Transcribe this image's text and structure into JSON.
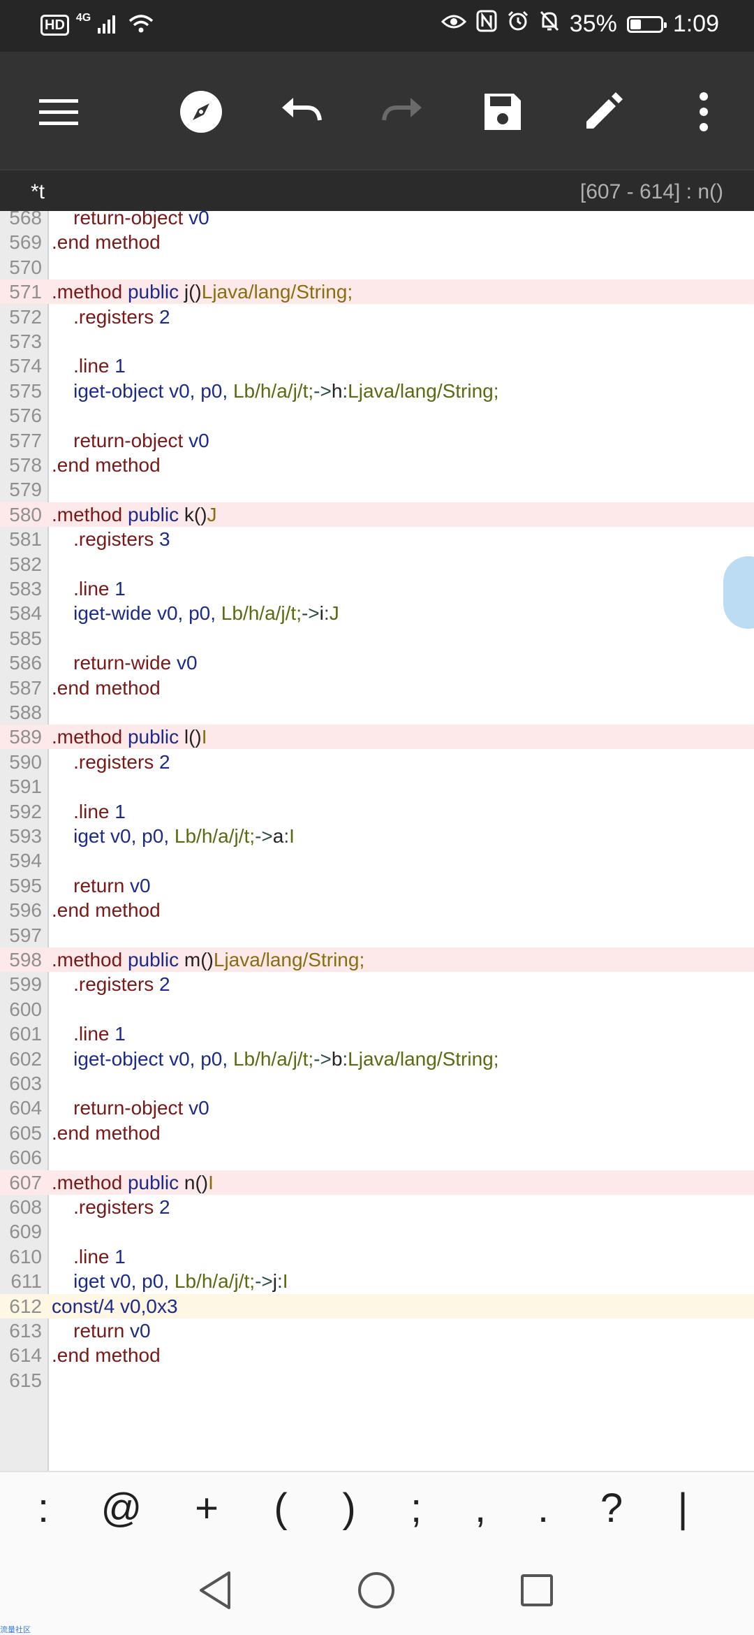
{
  "status_bar": {
    "hd_badge": "HD",
    "network": "4G",
    "battery_percent": "35%",
    "battery_level": 0.35,
    "time": "1:09"
  },
  "toolbar": {
    "icons": [
      "menu-icon",
      "compass-icon",
      "undo-icon",
      "redo-icon",
      "save-icon",
      "edit-icon",
      "more-vert-icon"
    ],
    "redo_enabled": false
  },
  "info_bar": {
    "file_name": "*t",
    "position": "[607 - 614] : n()"
  },
  "editor": {
    "lines": [
      {
        "num": "568",
        "tokens": [
          {
            "t": "    return-object ",
            "c": "kw"
          },
          {
            "t": "v0",
            "c": "reg"
          }
        ]
      },
      {
        "num": "569",
        "tokens": [
          {
            "t": ".end method",
            "c": "kw"
          }
        ]
      },
      {
        "num": "570",
        "tokens": []
      },
      {
        "num": "571",
        "hl": "method",
        "tokens": [
          {
            "t": ".method ",
            "c": "kw"
          },
          {
            "t": "public ",
            "c": "reg"
          },
          {
            "t": "j()",
            "c": "nm"
          },
          {
            "t": "Ljava/lang/String;",
            "c": "typ"
          }
        ]
      },
      {
        "num": "572",
        "tokens": [
          {
            "t": "    .registers ",
            "c": "kw"
          },
          {
            "t": "2",
            "c": "reg"
          }
        ]
      },
      {
        "num": "573",
        "tokens": []
      },
      {
        "num": "574",
        "tokens": [
          {
            "t": "    .line ",
            "c": "kw"
          },
          {
            "t": "1",
            "c": "reg"
          }
        ]
      },
      {
        "num": "575",
        "tokens": [
          {
            "t": "    iget-object ",
            "c": "reg"
          },
          {
            "t": "v0, p0, ",
            "c": "reg"
          },
          {
            "t": "Lb/h/a/j/t;",
            "c": "cls"
          },
          {
            "t": "->",
            "c": "op"
          },
          {
            "t": "h",
            "c": "nm"
          },
          {
            "t": ":",
            "c": "op"
          },
          {
            "t": "Ljava/lang/String;",
            "c": "cls"
          }
        ]
      },
      {
        "num": "576",
        "tokens": []
      },
      {
        "num": "577",
        "tokens": [
          {
            "t": "    return-object ",
            "c": "kw"
          },
          {
            "t": "v0",
            "c": "reg"
          }
        ]
      },
      {
        "num": "578",
        "tokens": [
          {
            "t": ".end method",
            "c": "kw"
          }
        ]
      },
      {
        "num": "579",
        "tokens": []
      },
      {
        "num": "580",
        "hl": "method",
        "tokens": [
          {
            "t": ".method ",
            "c": "kw"
          },
          {
            "t": "public ",
            "c": "reg"
          },
          {
            "t": "k()",
            "c": "nm"
          },
          {
            "t": "J",
            "c": "typ"
          }
        ]
      },
      {
        "num": "581",
        "tokens": [
          {
            "t": "    .registers ",
            "c": "kw"
          },
          {
            "t": "3",
            "c": "reg"
          }
        ]
      },
      {
        "num": "582",
        "tokens": []
      },
      {
        "num": "583",
        "tokens": [
          {
            "t": "    .line ",
            "c": "kw"
          },
          {
            "t": "1",
            "c": "reg"
          }
        ]
      },
      {
        "num": "584",
        "tokens": [
          {
            "t": "    iget-wide ",
            "c": "reg"
          },
          {
            "t": "v0, p0, ",
            "c": "reg"
          },
          {
            "t": "Lb/h/a/j/t;",
            "c": "cls"
          },
          {
            "t": "->",
            "c": "op"
          },
          {
            "t": "i",
            "c": "nm"
          },
          {
            "t": ":",
            "c": "op"
          },
          {
            "t": "J",
            "c": "cls"
          }
        ]
      },
      {
        "num": "585",
        "tokens": []
      },
      {
        "num": "586",
        "tokens": [
          {
            "t": "    return-wide ",
            "c": "kw"
          },
          {
            "t": "v0",
            "c": "reg"
          }
        ]
      },
      {
        "num": "587",
        "tokens": [
          {
            "t": ".end method",
            "c": "kw"
          }
        ]
      },
      {
        "num": "588",
        "tokens": []
      },
      {
        "num": "589",
        "hl": "method",
        "tokens": [
          {
            "t": ".method ",
            "c": "kw"
          },
          {
            "t": "public ",
            "c": "reg"
          },
          {
            "t": "l()",
            "c": "nm"
          },
          {
            "t": "I",
            "c": "typ"
          }
        ]
      },
      {
        "num": "590",
        "tokens": [
          {
            "t": "    .registers ",
            "c": "kw"
          },
          {
            "t": "2",
            "c": "reg"
          }
        ]
      },
      {
        "num": "591",
        "tokens": []
      },
      {
        "num": "592",
        "tokens": [
          {
            "t": "    .line ",
            "c": "kw"
          },
          {
            "t": "1",
            "c": "reg"
          }
        ]
      },
      {
        "num": "593",
        "tokens": [
          {
            "t": "    iget ",
            "c": "reg"
          },
          {
            "t": "v0, p0, ",
            "c": "reg"
          },
          {
            "t": "Lb/h/a/j/t;",
            "c": "cls"
          },
          {
            "t": "->",
            "c": "op"
          },
          {
            "t": "a",
            "c": "nm"
          },
          {
            "t": ":",
            "c": "op"
          },
          {
            "t": "I",
            "c": "cls"
          }
        ]
      },
      {
        "num": "594",
        "tokens": []
      },
      {
        "num": "595",
        "tokens": [
          {
            "t": "    return ",
            "c": "kw"
          },
          {
            "t": "v0",
            "c": "reg"
          }
        ]
      },
      {
        "num": "596",
        "tokens": [
          {
            "t": ".end method",
            "c": "kw"
          }
        ]
      },
      {
        "num": "597",
        "tokens": []
      },
      {
        "num": "598",
        "hl": "method",
        "tokens": [
          {
            "t": ".method ",
            "c": "kw"
          },
          {
            "t": "public ",
            "c": "reg"
          },
          {
            "t": "m()",
            "c": "nm"
          },
          {
            "t": "Ljava/lang/String;",
            "c": "typ"
          }
        ]
      },
      {
        "num": "599",
        "tokens": [
          {
            "t": "    .registers ",
            "c": "kw"
          },
          {
            "t": "2",
            "c": "reg"
          }
        ]
      },
      {
        "num": "600",
        "tokens": []
      },
      {
        "num": "601",
        "tokens": [
          {
            "t": "    .line ",
            "c": "kw"
          },
          {
            "t": "1",
            "c": "reg"
          }
        ]
      },
      {
        "num": "602",
        "tokens": [
          {
            "t": "    iget-object ",
            "c": "reg"
          },
          {
            "t": "v0, p0, ",
            "c": "reg"
          },
          {
            "t": "Lb/h/a/j/t;",
            "c": "cls"
          },
          {
            "t": "->",
            "c": "op"
          },
          {
            "t": "b",
            "c": "nm"
          },
          {
            "t": ":",
            "c": "op"
          },
          {
            "t": "Ljava/lang/String;",
            "c": "cls"
          }
        ]
      },
      {
        "num": "603",
        "tokens": []
      },
      {
        "num": "604",
        "tokens": [
          {
            "t": "    return-object ",
            "c": "kw"
          },
          {
            "t": "v0",
            "c": "reg"
          }
        ]
      },
      {
        "num": "605",
        "tokens": [
          {
            "t": ".end method",
            "c": "kw"
          }
        ]
      },
      {
        "num": "606",
        "tokens": []
      },
      {
        "num": "607",
        "hl": "method",
        "tokens": [
          {
            "t": ".method ",
            "c": "kw"
          },
          {
            "t": "public ",
            "c": "reg"
          },
          {
            "t": "n()",
            "c": "nm"
          },
          {
            "t": "I",
            "c": "typ"
          }
        ]
      },
      {
        "num": "608",
        "tokens": [
          {
            "t": "    .registers ",
            "c": "kw"
          },
          {
            "t": "2",
            "c": "reg"
          }
        ]
      },
      {
        "num": "609",
        "tokens": []
      },
      {
        "num": "610",
        "tokens": [
          {
            "t": "    .line ",
            "c": "kw"
          },
          {
            "t": "1",
            "c": "reg"
          }
        ]
      },
      {
        "num": "611",
        "tokens": [
          {
            "t": "    iget ",
            "c": "reg"
          },
          {
            "t": "v0, p0, ",
            "c": "reg"
          },
          {
            "t": "Lb/h/a/j/t;",
            "c": "cls"
          },
          {
            "t": "->",
            "c": "op"
          },
          {
            "t": "j",
            "c": "nm"
          },
          {
            "t": ":",
            "c": "op"
          },
          {
            "t": "I",
            "c": "cls"
          }
        ]
      },
      {
        "num": "612",
        "hl": "cursor",
        "tokens": [
          {
            "t": "const/4 v0,0x3",
            "c": "reg"
          }
        ]
      },
      {
        "num": "613",
        "tokens": [
          {
            "t": "    return ",
            "c": "kw"
          },
          {
            "t": "v0",
            "c": "reg"
          }
        ]
      },
      {
        "num": "614",
        "tokens": [
          {
            "t": ".end method",
            "c": "kw"
          }
        ]
      },
      {
        "num": "615",
        "tokens": []
      }
    ]
  },
  "symbol_bar": {
    "symbols": [
      ":",
      "@",
      "+",
      "(",
      ")",
      ";",
      ",",
      ".",
      "?",
      "|"
    ]
  },
  "nav_bar": {
    "icons": [
      "back-icon",
      "home-icon",
      "recents-icon"
    ]
  },
  "watermark": "流量社区",
  "colors": {
    "status_bg": "#262626",
    "toolbar_bg": "#333333",
    "method_highlight": "#fde9ea",
    "cursor_highlight": "#fdf7e3",
    "keyword": "#7a1818",
    "register": "#1c2a8c",
    "type": "#8a6e0e"
  }
}
